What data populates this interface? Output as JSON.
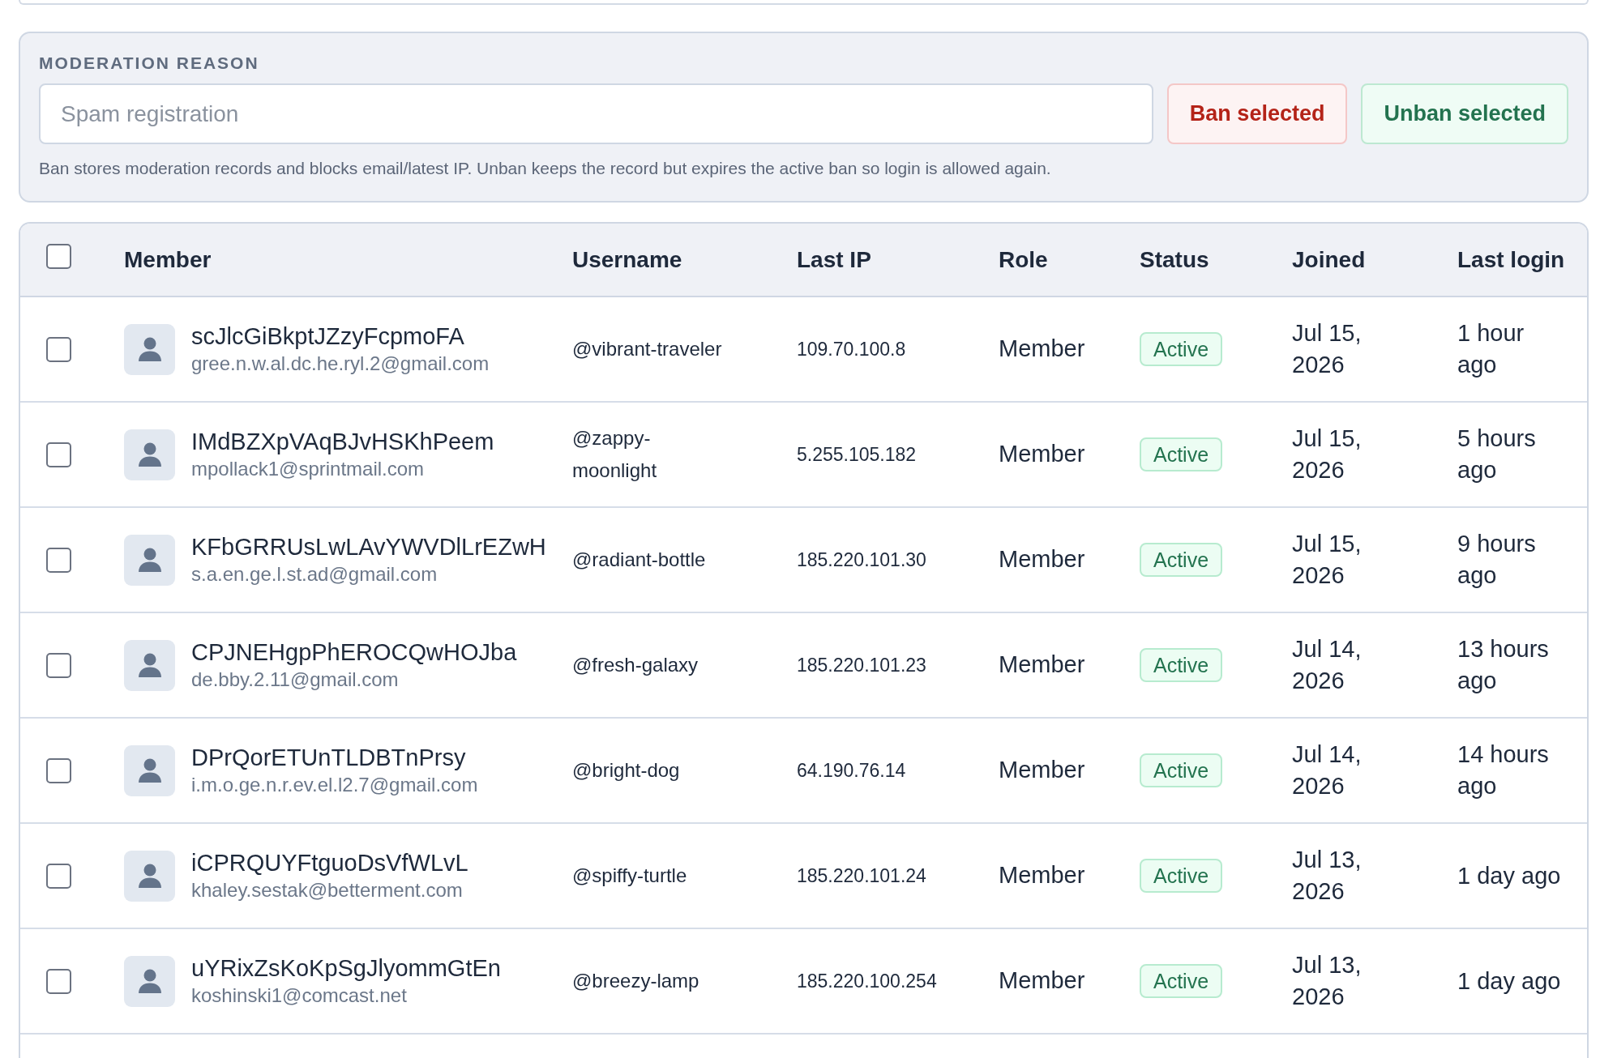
{
  "moderation": {
    "label": "MODERATION REASON",
    "reason_field": {
      "placeholder": "Spam registration"
    },
    "buttons": [
      {
        "label": "Ban selected",
        "kind": "danger"
      },
      {
        "label": "Unban selected",
        "kind": "success"
      }
    ],
    "help_text": "Ban stores moderation records and blocks email/latest IP. Unban keeps the record but expires the active ban so login is allowed again."
  },
  "table": {
    "select_all": {
      "checked": false
    },
    "columns": [
      "Member",
      "Username",
      "Last IP",
      "Role",
      "Status",
      "Joined",
      "Last login"
    ],
    "rows": [
      {
        "checked": false,
        "name": "scJlcGiBkptJZzyFcpmoFA",
        "email": "gree.n.w.al.dc.he.ryl.2@gmail.com",
        "username": "@vibrant-traveler",
        "last_ip": "109.70.100.8",
        "role": "Member",
        "status": {
          "label": "Active",
          "kind": "active"
        },
        "joined": "Jul 15, 2026",
        "last_login": "1 hour ago"
      },
      {
        "checked": false,
        "name": "IMdBZXpVAqBJvHSKhPeem",
        "email": "mpollack1@sprintmail.com",
        "username": "@zappy-moonlight",
        "last_ip": "5.255.105.182",
        "role": "Member",
        "status": {
          "label": "Active",
          "kind": "active"
        },
        "joined": "Jul 15, 2026",
        "last_login": "5 hours ago"
      },
      {
        "checked": false,
        "name": "KFbGRRUsLwLAvYWVDlLrEZwH",
        "email": "s.a.en.ge.l.st.ad@gmail.com",
        "username": "@radiant-bottle",
        "last_ip": "185.220.101.30",
        "role": "Member",
        "status": {
          "label": "Active",
          "kind": "active"
        },
        "joined": "Jul 15, 2026",
        "last_login": "9 hours ago"
      },
      {
        "checked": false,
        "name": "CPJNEHgpPhEROCQwHOJba",
        "email": "de.bby.2.11@gmail.com",
        "username": "@fresh-galaxy",
        "last_ip": "185.220.101.23",
        "role": "Member",
        "status": {
          "label": "Active",
          "kind": "active"
        },
        "joined": "Jul 14, 2026",
        "last_login": "13 hours ago"
      },
      {
        "checked": false,
        "name": "DPrQorETUnTLDBTnPrsy",
        "email": "i.m.o.ge.n.r.ev.el.l2.7@gmail.com",
        "username": "@bright-dog",
        "last_ip": "64.190.76.14",
        "role": "Member",
        "status": {
          "label": "Active",
          "kind": "active"
        },
        "joined": "Jul 14, 2026",
        "last_login": "14 hours ago"
      },
      {
        "checked": false,
        "name": "iCPRQUYFtguoDsVfWLvL",
        "email": "khaley.sestak@betterment.com",
        "username": "@spiffy-turtle",
        "last_ip": "185.220.101.24",
        "role": "Member",
        "status": {
          "label": "Active",
          "kind": "active"
        },
        "joined": "Jul 13, 2026",
        "last_login": "1 day ago"
      },
      {
        "checked": false,
        "name": "uYRixZsKoKpSgJlyommGtEn",
        "email": "koshinski1@comcast.net",
        "username": "@breezy-lamp",
        "last_ip": "185.220.100.254",
        "role": "Member",
        "status": {
          "label": "Active",
          "kind": "active"
        },
        "joined": "Jul 13, 2026",
        "last_login": "1 day ago"
      }
    ]
  }
}
